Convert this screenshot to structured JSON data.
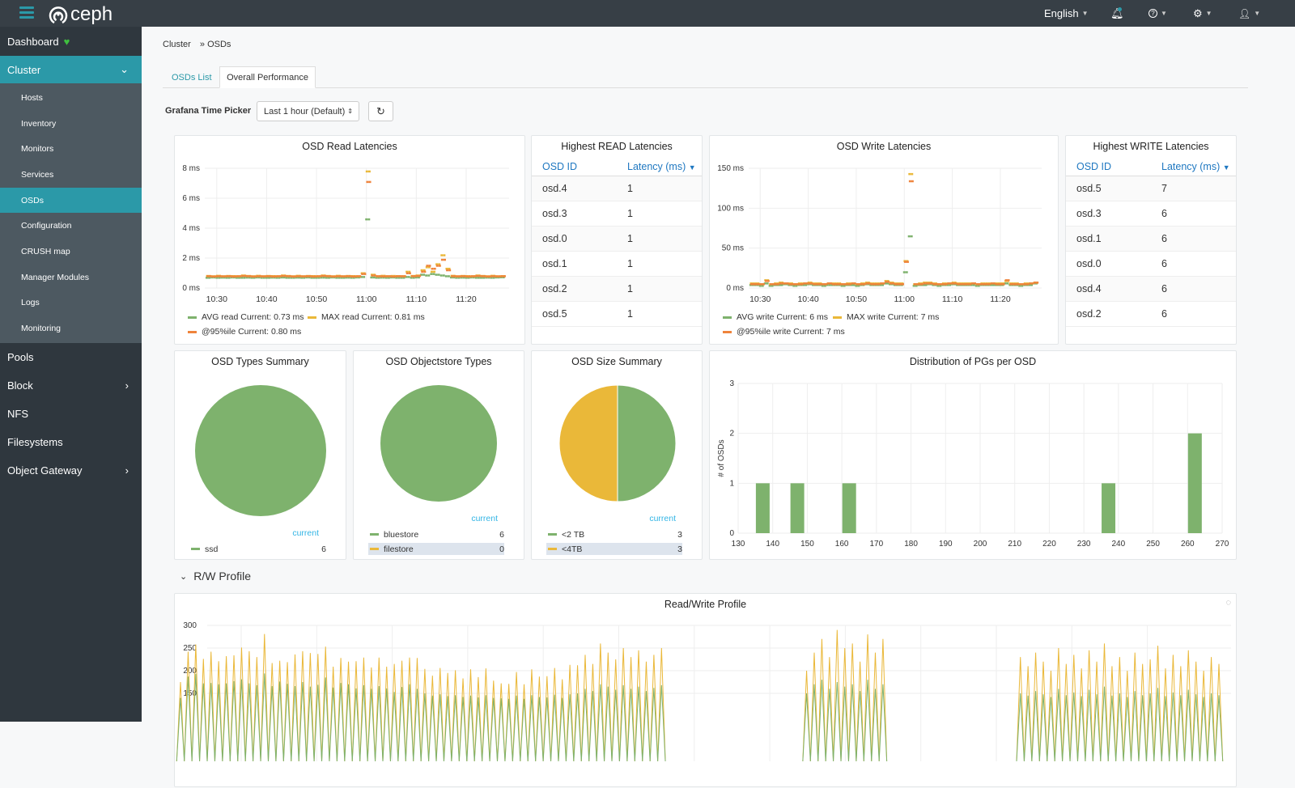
{
  "topbar": {
    "brand": "ceph",
    "language": "English",
    "icons": [
      "menu-icon",
      "bell-icon",
      "help-icon",
      "gear-icon",
      "user-icon"
    ]
  },
  "sidebar": {
    "top": [
      {
        "label": "Dashboard"
      },
      {
        "label": "Cluster"
      }
    ],
    "cluster_items": [
      {
        "label": "Hosts"
      },
      {
        "label": "Inventory"
      },
      {
        "label": "Monitors"
      },
      {
        "label": "Services"
      },
      {
        "label": "OSDs"
      },
      {
        "label": "Configuration"
      },
      {
        "label": "CRUSH map"
      },
      {
        "label": "Manager Modules"
      },
      {
        "label": "Logs"
      },
      {
        "label": "Monitoring"
      }
    ],
    "bottom": [
      {
        "label": "Pools"
      },
      {
        "label": "Block"
      },
      {
        "label": "NFS"
      },
      {
        "label": "Filesystems"
      },
      {
        "label": "Object Gateway"
      }
    ],
    "active": "OSDs"
  },
  "breadcrumb": {
    "parent": "Cluster",
    "sep": "»",
    "current": "OSDs"
  },
  "tabs": [
    {
      "label": "OSDs List"
    },
    {
      "label": "Overall Performance",
      "active": true
    }
  ],
  "picker": {
    "label": "Grafana Time Picker",
    "value": "Last 1 hour (Default)"
  },
  "colors": {
    "green": "#7eb26d",
    "yellow": "#eab839",
    "orange": "#ef843c",
    "teal": "#2b99a8",
    "link": "#1f78c1"
  },
  "read_table": {
    "title": "Highest READ Latencies",
    "col1": "OSD ID",
    "col2": "Latency (ms)",
    "rows": [
      [
        "osd.4",
        "1"
      ],
      [
        "osd.3",
        "1"
      ],
      [
        "osd.0",
        "1"
      ],
      [
        "osd.1",
        "1"
      ],
      [
        "osd.2",
        "1"
      ],
      [
        "osd.5",
        "1"
      ]
    ]
  },
  "write_table": {
    "title": "Highest WRITE Latencies",
    "col1": "OSD ID",
    "col2": "Latency (ms)",
    "rows": [
      [
        "osd.5",
        "7"
      ],
      [
        "osd.3",
        "6"
      ],
      [
        "osd.1",
        "6"
      ],
      [
        "osd.0",
        "6"
      ],
      [
        "osd.4",
        "6"
      ],
      [
        "osd.2",
        "6"
      ]
    ]
  },
  "section": {
    "rw_label": "R/W Profile"
  },
  "chart_data": [
    {
      "id": "read",
      "type": "scatter",
      "title": "OSD Read Latencies",
      "ylim": [
        0,
        8
      ],
      "yticks": [
        "0 ms",
        "2 ms",
        "4 ms",
        "6 ms",
        "8 ms"
      ],
      "xlim": [
        "10:27",
        "11:28"
      ],
      "xticks": [
        "10:30",
        "10:40",
        "10:50",
        "11:00",
        "11:10",
        "11:20"
      ],
      "x_start": "10:28",
      "x_step_min": 1,
      "series": [
        {
          "name": "AVG read",
          "legend": "AVG read  Current: 0.73 ms",
          "color": "#7eb26d",
          "values": [
            0.7,
            0.72,
            0.7,
            0.71,
            0.7,
            0.72,
            0.7,
            0.7,
            0.71,
            0.7,
            0.72,
            0.7,
            0.7,
            0.71,
            0.7,
            0.72,
            0.7,
            0.7,
            0.71,
            0.7,
            0.72,
            0.7,
            0.7,
            0.71,
            0.7,
            0.72,
            0.7,
            0.7,
            0.71,
            0.7,
            0.72,
            0.75,
            4.6,
            0.72,
            0.7,
            0.71,
            0.7,
            0.72,
            0.7,
            0.7,
            0.75,
            0.7,
            0.72,
            0.9,
            0.85,
            0.95,
            0.9,
            0.85,
            0.8,
            0.72,
            0.7,
            0.71,
            0.7,
            0.72,
            0.7,
            0.7,
            0.71,
            0.7,
            0.72,
            0.73
          ]
        },
        {
          "name": "MAX read",
          "legend": "MAX read  Current: 0.81 ms",
          "color": "#eab839",
          "values": [
            0.82,
            0.8,
            0.83,
            0.8,
            0.82,
            0.81,
            0.8,
            0.85,
            0.82,
            0.8,
            0.83,
            0.8,
            0.82,
            0.81,
            0.8,
            0.85,
            0.82,
            0.8,
            0.83,
            0.8,
            0.82,
            0.81,
            0.8,
            0.85,
            0.82,
            0.8,
            0.83,
            0.8,
            0.82,
            0.81,
            0.8,
            1.0,
            7.8,
            0.9,
            0.8,
            0.83,
            0.8,
            0.82,
            0.81,
            0.8,
            1.1,
            0.82,
            0.85,
            1.2,
            1.4,
            1.1,
            1.6,
            2.2,
            1.3,
            0.83,
            0.8,
            0.82,
            0.81,
            0.8,
            0.85,
            0.82,
            0.8,
            0.83,
            0.8,
            0.81
          ]
        },
        {
          "name": "@95%ile",
          "legend": "@95%ile  Current: 0.80 ms",
          "color": "#ef843c",
          "values": [
            0.8,
            0.78,
            0.8,
            0.79,
            0.8,
            0.78,
            0.8,
            0.82,
            0.8,
            0.78,
            0.8,
            0.79,
            0.8,
            0.78,
            0.8,
            0.82,
            0.8,
            0.78,
            0.8,
            0.79,
            0.8,
            0.78,
            0.8,
            0.82,
            0.8,
            0.78,
            0.8,
            0.79,
            0.8,
            0.78,
            0.8,
            0.95,
            7.1,
            0.85,
            0.8,
            0.79,
            0.8,
            0.78,
            0.8,
            0.8,
            1.0,
            0.8,
            0.82,
            1.1,
            1.5,
            1.3,
            1.5,
            1.9,
            1.2,
            0.8,
            0.79,
            0.8,
            0.78,
            0.8,
            0.82,
            0.8,
            0.78,
            0.8,
            0.79,
            0.8
          ]
        }
      ]
    },
    {
      "id": "write",
      "type": "scatter",
      "title": "OSD Write Latencies",
      "ylim": [
        0,
        150
      ],
      "yticks": [
        "0 ms",
        "50 ms",
        "100 ms",
        "150 ms"
      ],
      "xlim": [
        "10:27",
        "11:28"
      ],
      "xticks": [
        "10:30",
        "10:40",
        "10:50",
        "11:00",
        "11:10",
        "11:20"
      ],
      "x_start": "10:28",
      "x_step_min": 1,
      "series": [
        {
          "name": "AVG write",
          "legend": "AVG write  Current: 6 ms",
          "color": "#7eb26d",
          "values": [
            4,
            4,
            3,
            6,
            3,
            4,
            4,
            5,
            4,
            3,
            4,
            4,
            5,
            4,
            4,
            3,
            4,
            4,
            4,
            3,
            4,
            4,
            3,
            4,
            5,
            4,
            4,
            4,
            6,
            5,
            4,
            4,
            20,
            65,
            3,
            4,
            4,
            5,
            4,
            3,
            4,
            4,
            5,
            4,
            4,
            4,
            4,
            3,
            4,
            4,
            4,
            4,
            4,
            6,
            4,
            4,
            3,
            4,
            4,
            6
          ]
        },
        {
          "name": "MAX write",
          "legend": "MAX write  Current: 7 ms",
          "color": "#eab839",
          "values": [
            6,
            6,
            5,
            10,
            5,
            6,
            7,
            6,
            6,
            5,
            6,
            6,
            7,
            6,
            6,
            5,
            6,
            6,
            6,
            5,
            6,
            6,
            5,
            6,
            7,
            6,
            6,
            6,
            9,
            7,
            6,
            6,
            34,
            143,
            5,
            6,
            7,
            7,
            6,
            5,
            6,
            6,
            7,
            6,
            6,
            6,
            6,
            5,
            6,
            6,
            6,
            6,
            6,
            9,
            6,
            6,
            5,
            6,
            6,
            7
          ]
        },
        {
          "name": "@95%ile write",
          "legend": "@95%ile write  Current: 7 ms",
          "color": "#ef843c",
          "values": [
            5,
            5,
            5,
            9,
            5,
            5,
            6,
            6,
            5,
            5,
            5,
            6,
            6,
            5,
            5,
            5,
            6,
            5,
            5,
            5,
            5,
            6,
            5,
            5,
            6,
            5,
            5,
            6,
            8,
            6,
            5,
            5,
            33,
            134,
            5,
            5,
            6,
            6,
            5,
            5,
            5,
            6,
            6,
            5,
            5,
            5,
            6,
            5,
            5,
            5,
            6,
            5,
            5,
            10,
            5,
            5,
            5,
            5,
            6,
            7
          ]
        }
      ]
    },
    {
      "id": "types",
      "type": "pie",
      "title": "OSD Types Summary",
      "legend_header": "current",
      "slices": [
        {
          "label": "ssd",
          "value": 6,
          "color": "#7eb26d"
        }
      ]
    },
    {
      "id": "objectstore",
      "type": "pie",
      "title": "OSD Objectstore Types",
      "legend_header": "current",
      "slices": [
        {
          "label": "bluestore",
          "value": 6,
          "color": "#7eb26d"
        },
        {
          "label": "filestore",
          "value": 0,
          "color": "#eab839"
        }
      ]
    },
    {
      "id": "size",
      "type": "pie",
      "title": "OSD Size Summary",
      "legend_header": "current",
      "slices": [
        {
          "label": "<2 TB",
          "value": 3,
          "color": "#7eb26d"
        },
        {
          "label": "<4TB",
          "value": 3,
          "color": "#eab839"
        }
      ]
    },
    {
      "id": "pgs",
      "type": "bar",
      "title": "Distribution of PGs per OSD",
      "ylabel": "# of OSDs",
      "xlim": [
        130,
        270
      ],
      "ylim": [
        0,
        3
      ],
      "xticks": [
        130,
        140,
        150,
        160,
        170,
        180,
        190,
        200,
        210,
        220,
        230,
        240,
        250,
        260,
        270
      ],
      "yticks": [
        0,
        1,
        2,
        3
      ],
      "x": [
        137,
        147,
        162,
        237,
        262
      ],
      "values": [
        1,
        1,
        1,
        1,
        2
      ],
      "color": "#7eb26d"
    },
    {
      "id": "rw",
      "type": "line",
      "title": "Read/Write Profile",
      "ylim": [
        0,
        300
      ],
      "yticks": [
        150,
        200,
        250,
        300
      ],
      "series": [
        {
          "color": "#eab839",
          "values": [
            175,
            242,
            258,
            226,
            242,
            221,
            232,
            234,
            251,
            243,
            230,
            281,
            217,
            222,
            219,
            236,
            243,
            239,
            237,
            253,
            209,
            228,
            220,
            221,
            229,
            207,
            229,
            209,
            215,
            222,
            229,
            228,
            204,
            189,
            206,
            195,
            201,
            183,
            203,
            186,
            205,
            178,
            172,
            171,
            197,
            170,
            203,
            187,
            188,
            206,
            181,
            213,
            212,
            235,
            215,
            260,
            240,
            225,
            250,
            230,
            245,
            220,
            235,
            250,
            null,
            null,
            null,
            null,
            null,
            null,
            null,
            null,
            null,
            null,
            null,
            null,
            null,
            null,
            null,
            null,
            null,
            null,
            200,
            240,
            270,
            230,
            290,
            250,
            260,
            220,
            280,
            240,
            270,
            null,
            null,
            null,
            null,
            null,
            null,
            null,
            null,
            null,
            null,
            null,
            null,
            null,
            null,
            null,
            null,
            null,
            230,
            210,
            240,
            220,
            200,
            250,
            215,
            235,
            205,
            245,
            220,
            260,
            210,
            230,
            200,
            240,
            215,
            225,
            255,
            205,
            235,
            210,
            245,
            220,
            200,
            230,
            215
          ]
        },
        {
          "color": "#7eb26d",
          "values": [
            140,
            187,
            193,
            172,
            173,
            170,
            172,
            177,
            181,
            172,
            168,
            194,
            166,
            176,
            171,
            166,
            175,
            165,
            169,
            185,
            163,
            173,
            170,
            161,
            168,
            160,
            166,
            161,
            153,
            164,
            170,
            160,
            150,
            145,
            148,
            144,
            146,
            142,
            145,
            141,
            146,
            140,
            139,
            138,
            145,
            138,
            146,
            142,
            141,
            147,
            140,
            148,
            150,
            160,
            155,
            170,
            165,
            158,
            168,
            160,
            165,
            155,
            162,
            168,
            null,
            null,
            null,
            null,
            null,
            null,
            null,
            null,
            null,
            null,
            null,
            null,
            null,
            null,
            null,
            null,
            null,
            null,
            150,
            170,
            180,
            160,
            175,
            165,
            170,
            155,
            180,
            160,
            170,
            null,
            null,
            null,
            null,
            null,
            null,
            null,
            null,
            null,
            null,
            null,
            null,
            null,
            null,
            null,
            null,
            null,
            150,
            145,
            155,
            148,
            142,
            160,
            146,
            152,
            144,
            158,
            148,
            165,
            145,
            150,
            142,
            155,
            146,
            150,
            162,
            144,
            152,
            146,
            158,
            148,
            142,
            150,
            146
          ]
        }
      ]
    }
  ]
}
